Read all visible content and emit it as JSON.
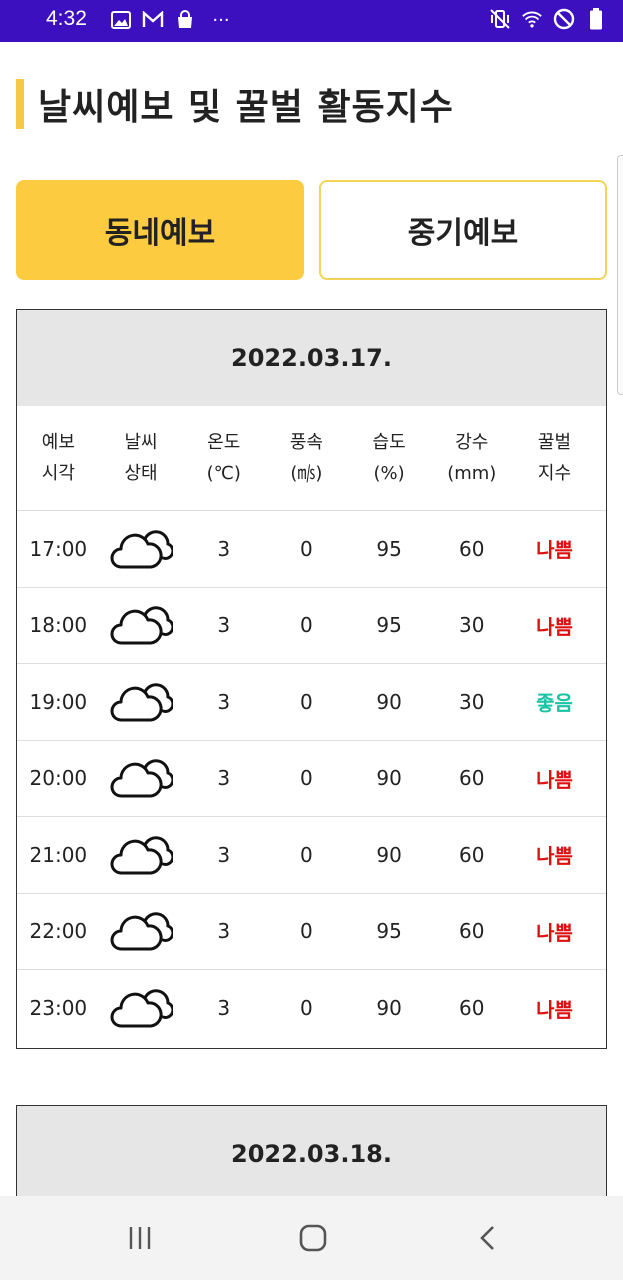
{
  "status_bar": {
    "time": "4:32",
    "left_icons": [
      "gallery-icon",
      "gmail-icon",
      "shopping-bag-icon",
      "more-icon"
    ],
    "right_icons": [
      "vibrate-icon",
      "wifi-icon",
      "do-not-disturb-icon",
      "battery-icon"
    ],
    "more_glyph": "···"
  },
  "page": {
    "title": "날씨예보 및 꿀벌 활동지수",
    "accent_color": "#fdcb3f"
  },
  "tabs": [
    {
      "label": "동네예보",
      "active": true
    },
    {
      "label": "중기예보",
      "active": false
    }
  ],
  "table_headers": [
    "예보\n시각",
    "날씨\n상태",
    "온도\n(℃)",
    "풍속\n(㎧)",
    "습도\n(%)",
    "강수\n(mm)",
    "꿀벌\n지수"
  ],
  "days": [
    {
      "date": "2022.03.17.",
      "rows": [
        {
          "time": "17:00",
          "weather": "cloudy-icon",
          "temp": "3",
          "wind": "0",
          "humidity": "95",
          "rain": "60",
          "index": "나쁨",
          "index_level": "bad"
        },
        {
          "time": "18:00",
          "weather": "cloudy-icon",
          "temp": "3",
          "wind": "0",
          "humidity": "95",
          "rain": "30",
          "index": "나쁨",
          "index_level": "bad"
        },
        {
          "time": "19:00",
          "weather": "cloudy-icon",
          "temp": "3",
          "wind": "0",
          "humidity": "90",
          "rain": "30",
          "index": "좋음",
          "index_level": "good"
        },
        {
          "time": "20:00",
          "weather": "cloudy-icon",
          "temp": "3",
          "wind": "0",
          "humidity": "90",
          "rain": "60",
          "index": "나쁨",
          "index_level": "bad"
        },
        {
          "time": "21:00",
          "weather": "cloudy-icon",
          "temp": "3",
          "wind": "0",
          "humidity": "90",
          "rain": "60",
          "index": "나쁨",
          "index_level": "bad"
        },
        {
          "time": "22:00",
          "weather": "cloudy-icon",
          "temp": "3",
          "wind": "0",
          "humidity": "95",
          "rain": "60",
          "index": "나쁨",
          "index_level": "bad"
        },
        {
          "time": "23:00",
          "weather": "cloudy-icon",
          "temp": "3",
          "wind": "0",
          "humidity": "90",
          "rain": "60",
          "index": "나쁨",
          "index_level": "bad"
        }
      ]
    },
    {
      "date": "2022.03.18.",
      "rows": []
    }
  ],
  "colors": {
    "status_bar": "#3c0fbf",
    "index_bad": "#dd1111",
    "index_good": "#19c4a5",
    "tab_border": "#f3d35a"
  },
  "nav_bar": {
    "buttons": [
      "recent-apps-icon",
      "home-icon",
      "back-icon"
    ]
  }
}
